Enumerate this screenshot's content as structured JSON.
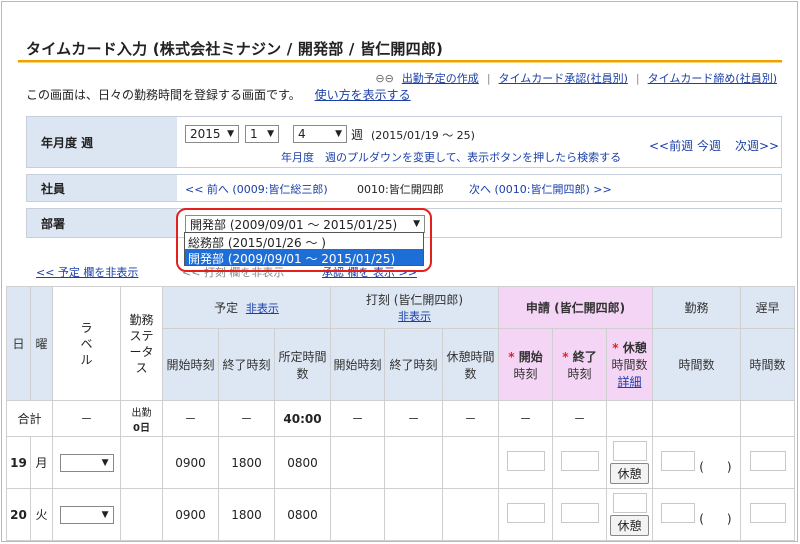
{
  "title": "タイムカード入力 (株式会社ミナジン / 開発部 / 皆仁開四郎)",
  "top_links": [
    "出勤予定の作成",
    "タイムカード承認(社員別)",
    "タイムカード締め(社員別)"
  ],
  "description": "この画面は、日々の勤務時間を登録する画面です。",
  "howto_link": "使い方を表示する",
  "week_panel": {
    "label": "年月度 週",
    "year": "2015",
    "month": "1",
    "week": "4",
    "week_suffix": "週",
    "range": "(2015/01/19 ～ 25)",
    "hint": "年月度　週のプルダウンを変更して、表示ボタンを押したら検索する",
    "prev": "<<前週",
    "current": "今週",
    "next": "次週>>"
  },
  "employee_panel": {
    "label": "社員",
    "prev": "<< 前へ (0009:皆仁総三郎)",
    "current": "0010:皆仁開四郎",
    "next": "次へ (0010:皆仁開四郎) >>"
  },
  "dept_panel": {
    "label": "部署",
    "selected": "開発部 (2009/09/01 ～ 2015/01/25)",
    "options": [
      "総務部 (2015/01/26 ～ )",
      "開発部 (2009/09/01 ～ 2015/01/25)"
    ]
  },
  "toggles": {
    "plan_hide": "<< 予定 欄を非表示",
    "stamp_hide": "<< 打刻 欄を非表示",
    "approve_show": "承認 欄を 表示 >>"
  },
  "table": {
    "day": "日",
    "weekday": "曜",
    "label": "ラベル",
    "status": "勤務ステータス",
    "plan": "予定",
    "plan_hide": "非表示",
    "stamp": "打刻 (皆仁開四郎)",
    "stamp_hide": "非表示",
    "request": "申請 (皆仁開四郎)",
    "work": "勤務",
    "late": "遅早",
    "sub": {
      "start": "開始時刻",
      "end": "終了時刻",
      "scheduled": "所定時間数",
      "s_start": "開始時刻",
      "s_end": "終了時刻",
      "s_break": "休憩時間数",
      "r_start": "開始",
      "r_start2": "時刻",
      "r_end": "終了",
      "r_end2": "時刻",
      "r_break": "休憩",
      "r_break2": "時間数",
      "r_detail": "詳細",
      "work_hours": "時間数",
      "late_hours": "時間数"
    },
    "total": {
      "label": "合計",
      "dash": "－",
      "attend": "出勤",
      "attend_days": "0日",
      "scheduled": "40:00"
    },
    "rows": [
      {
        "day": "19",
        "wd": "月",
        "start": "0900",
        "end": "1800",
        "sched": "0800",
        "break_btn": "休憩"
      },
      {
        "day": "20",
        "wd": "火",
        "start": "0900",
        "end": "1800",
        "sched": "0800",
        "break_btn": "休憩"
      }
    ]
  }
}
